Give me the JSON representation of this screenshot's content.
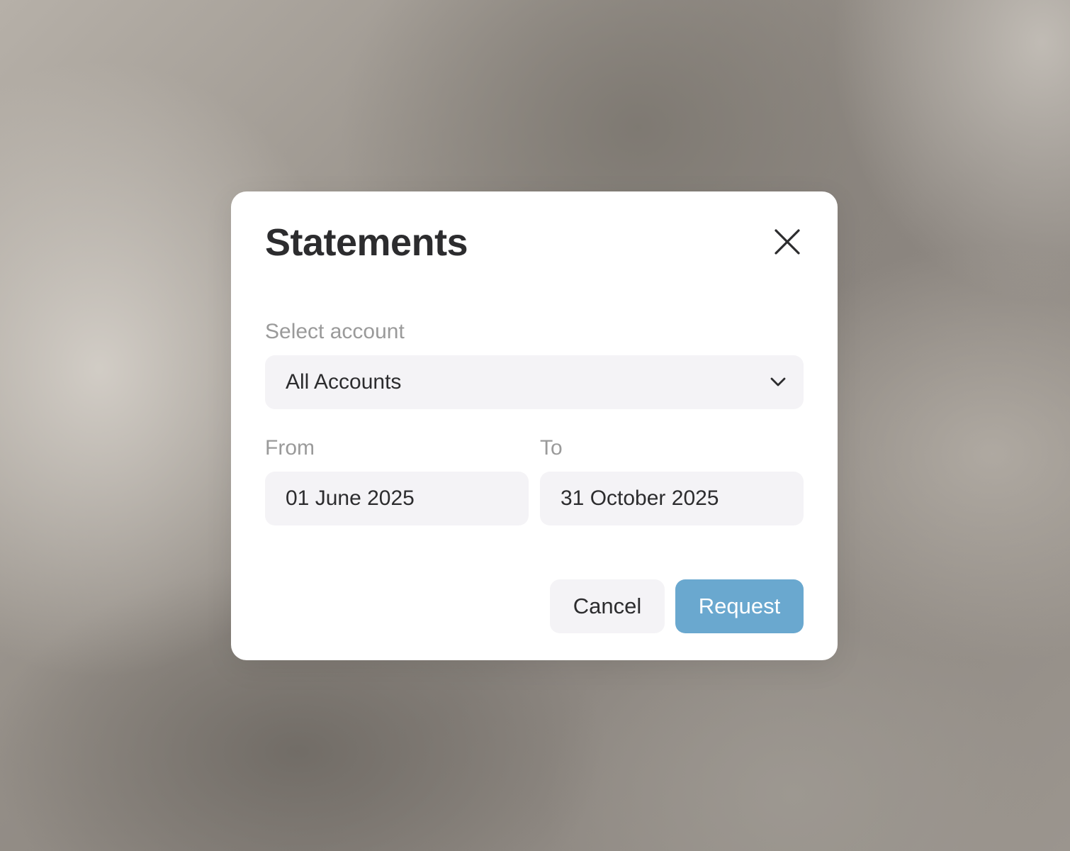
{
  "modal": {
    "title": "Statements",
    "close_icon": "close-icon"
  },
  "account": {
    "label": "Select account",
    "selected": "All Accounts",
    "chevron_icon": "chevron-down-icon"
  },
  "dates": {
    "from_label": "From",
    "from_value": "01 June 2025",
    "to_label": "To",
    "to_value": "31 October 2025"
  },
  "actions": {
    "cancel_label": "Cancel",
    "request_label": "Request"
  },
  "colors": {
    "primary_button": "#6aa8cf",
    "field_background": "#f4f3f6",
    "title_text": "#2c2c2e",
    "label_text": "#9a9a9a"
  }
}
